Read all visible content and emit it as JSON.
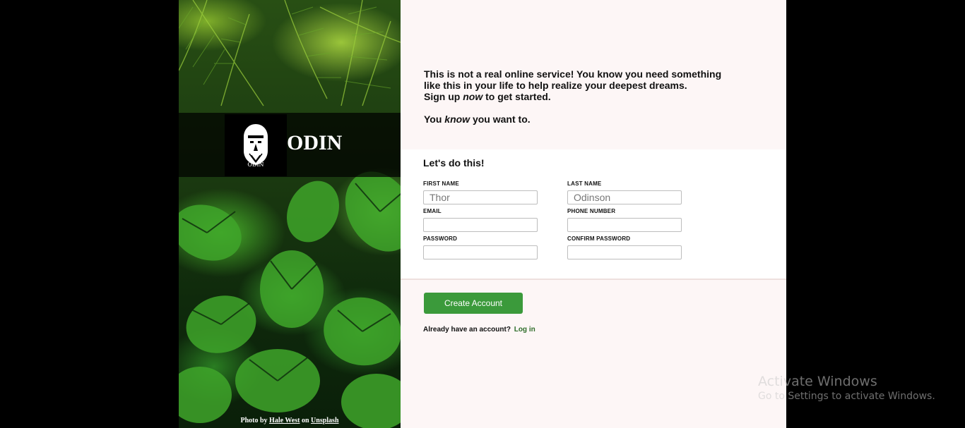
{
  "brand": {
    "name": "ODIN",
    "logo_caption": "ODIN"
  },
  "photo_credit": {
    "prefix": "Photo by",
    "author": "Hale West",
    "middle": "on",
    "source": "Unsplash"
  },
  "intro": {
    "line1": "This is not a real online service! You know you need something like this in your life to help realize your deepest dreams.",
    "line2_pre": "Sign up ",
    "line2_em": "now",
    "line2_post": " to get started.",
    "line3_pre": "You ",
    "line3_em": "know",
    "line3_post": " you want to."
  },
  "form": {
    "title": "Let's do this!",
    "fields": {
      "first_name": {
        "label": "FIRST NAME",
        "placeholder": "Thor"
      },
      "last_name": {
        "label": "LAST NAME",
        "placeholder": "Odinson"
      },
      "email": {
        "label": "EMAIL",
        "placeholder": ""
      },
      "phone": {
        "label": "PHONE NUMBER",
        "placeholder": ""
      },
      "password": {
        "label": "PASSWORD",
        "placeholder": ""
      },
      "confirm_password": {
        "label": "CONFIRM PASSWORD",
        "placeholder": ""
      }
    }
  },
  "actions": {
    "create_label": "Create Account",
    "login_prompt": "Already have an account?",
    "login_link": "Log in"
  },
  "colors": {
    "accent": "#3b9a3b",
    "link": "#2f6d2a",
    "panel_bg": "#fdf6f6"
  },
  "watermark": {
    "title": "Activate Windows",
    "subtitle": "Go to Settings to activate Windows."
  }
}
